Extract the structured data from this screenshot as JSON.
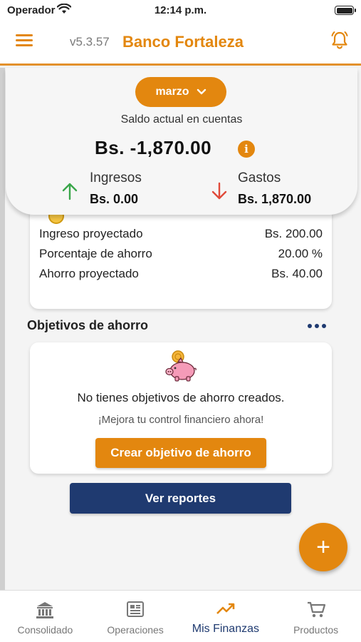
{
  "status_bar": {
    "carrier": "Operador",
    "time": "12:14 p.m."
  },
  "app_bar": {
    "version": "v5.3.57",
    "brand": "Banco Fortaleza"
  },
  "summary": {
    "month": "marzo",
    "balance_label": "Saldo actual en cuentas",
    "balance_value": "Bs. -1,870.00",
    "income_label": "Ingresos",
    "income_value": "Bs. 0.00",
    "expense_label": "Gastos",
    "expense_value": "Bs. 1,870.00"
  },
  "projection": {
    "rows": [
      {
        "label": "Ingreso proyectado",
        "value": "Bs. 200.00"
      },
      {
        "label": "Porcentaje de ahorro",
        "value": "20.00 %"
      },
      {
        "label": "Ahorro proyectado",
        "value": "Bs. 40.00"
      }
    ]
  },
  "goals": {
    "title": "Objetivos de ahorro",
    "empty_title": "No tienes objetivos de ahorro creados.",
    "empty_subtitle": "¡Mejora tu control financiero ahora!",
    "create_button": "Crear objetivo de ahorro"
  },
  "reports_button": "Ver reportes",
  "fab_label": "+",
  "tabs": [
    {
      "label": "Consolidado",
      "icon": "bank-icon"
    },
    {
      "label": "Operaciones",
      "icon": "operations-icon"
    },
    {
      "label": "Mis Finanzas",
      "icon": "trending-up-icon",
      "active": true
    },
    {
      "label": "Productos",
      "icon": "cart-icon"
    }
  ],
  "colors": {
    "accent": "#e3870f",
    "navy": "#1f3a70",
    "income_arrow": "#3aa64a",
    "expense_arrow": "#e04a3a"
  }
}
